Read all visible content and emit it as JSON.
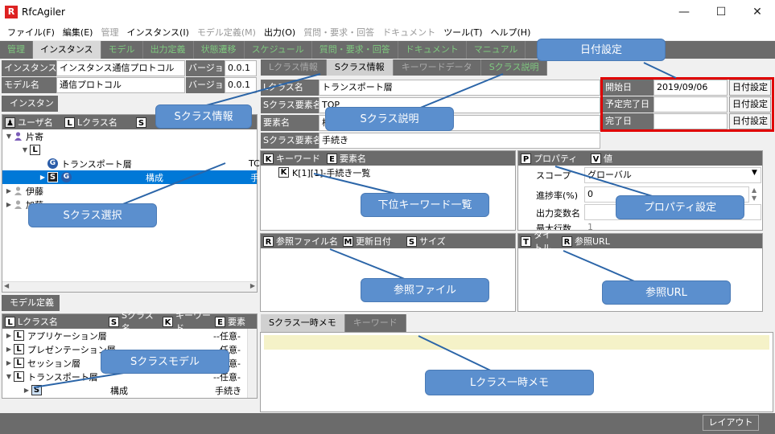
{
  "window": {
    "title": "RfcAgiler",
    "minimize": "—",
    "maximize": "☐",
    "close": "✕"
  },
  "menu": [
    "ファイル(F)",
    "編集(E)",
    "管理",
    "インスタンス(I)",
    "モデル定義(M)",
    "出力(O)",
    "質問・要求・回答",
    "ドキュメント",
    "ツール(T)",
    "ヘルプ(H)"
  ],
  "main_tabs": [
    "管理",
    "インスタンス",
    "モデル",
    "出力定義",
    "状態遷移",
    "スケジュール",
    "質問・要求・回答",
    "ドキュメント",
    "マニュアル"
  ],
  "instance_fields": {
    "instance_label": "インスタンス名",
    "instance_value": "インスタンス通信プロトコル",
    "version_label": "バージョン",
    "version_value": "0.0.1",
    "model_label": "モデル名",
    "model_value": "通信プロトコル",
    "model_version_label": "バージョン",
    "model_version_value": "0.0.1"
  },
  "instance_tab": "インスタンス",
  "instance_tree_headers": {
    "user": "ユーザ名",
    "lclass": "Lクラス名",
    "s": "S"
  },
  "instance_tree": [
    {
      "label": "片寄",
      "type": "user"
    },
    {
      "label": "",
      "type": "L"
    },
    {
      "label": "トランスポート層",
      "type": "G",
      "extra": "TC"
    },
    {
      "label": "構成",
      "type": "SG",
      "extra": "手"
    },
    {
      "label": "伊藤",
      "type": "user"
    },
    {
      "label": "加藤",
      "type": "user"
    }
  ],
  "model_tab": "モデル定義",
  "model_headers": {
    "lclass": "Lクラス名",
    "sclass": "Sクラス名",
    "keyword": "キーワード",
    "element": "要素"
  },
  "model_tree": [
    {
      "label": "アプリケーション層",
      "extra": "--任意-"
    },
    {
      "label": "プレゼンテーション層",
      "extra": "--任意-"
    },
    {
      "label": "セッション層",
      "extra": "--任意-"
    },
    {
      "label": "トランスポート層",
      "extra": "--任意-"
    },
    {
      "label": "構成",
      "extra": "手続き"
    }
  ],
  "sub_tabs": [
    "Lクラス情報",
    "Sクラス情報",
    "キーワードデータ",
    "Sクラス説明"
  ],
  "sclass_fields": [
    {
      "label": "Lクラス名",
      "value": "トランスポート層"
    },
    {
      "label": "Sクラス要素名",
      "value": "TOP"
    },
    {
      "label": "要素名",
      "value": "構成"
    },
    {
      "label": "Sクラス要素名",
      "value": "手続き"
    }
  ],
  "date_fields": [
    {
      "label": "開始日",
      "value": "2019/09/06",
      "button": "日付設定"
    },
    {
      "label": "予定完了日",
      "value": "",
      "button": "日付設定"
    },
    {
      "label": "完了日",
      "value": "",
      "button": "日付設定"
    }
  ],
  "keyword_headers": {
    "k": "キーワード",
    "e": "要素名"
  },
  "keyword_item": "K[1][1]-手続き一覧",
  "property_headers": {
    "p": "プロパティ",
    "v": "値"
  },
  "properties": [
    {
      "label": "スコープ",
      "value": "グローバル"
    },
    {
      "label": "進捗率(%)",
      "value": "0"
    },
    {
      "label": "出力変数名",
      "value": ""
    },
    {
      "label": "最大行数",
      "value": "1"
    }
  ],
  "ref_headers": {
    "r": "参照ファイル名",
    "m": "更新日付",
    "s": "サイズ"
  },
  "url_headers": {
    "t": "タイトル",
    "r": "参照URL"
  },
  "memo_tabs": [
    "Sクラス一時メモ",
    "キーワード"
  ],
  "status": {
    "layout_button": "レイアウト"
  },
  "callouts": {
    "date": "日付設定",
    "sinfo": "Sクラス情報",
    "sdesc": "Sクラス説明",
    "ssel": "Sクラス選択",
    "keywords": "下位キーワード一覧",
    "props": "プロパティ設定",
    "reffile": "参照ファイル",
    "refurl": "参照URL",
    "smodel": "Sクラスモデル",
    "memo": "Lクラス一時メモ"
  },
  "colors": {
    "highlight": "#e00000",
    "callout": "#5b8fce",
    "selected": "#0078d7",
    "memo": "#f5f2c8"
  }
}
